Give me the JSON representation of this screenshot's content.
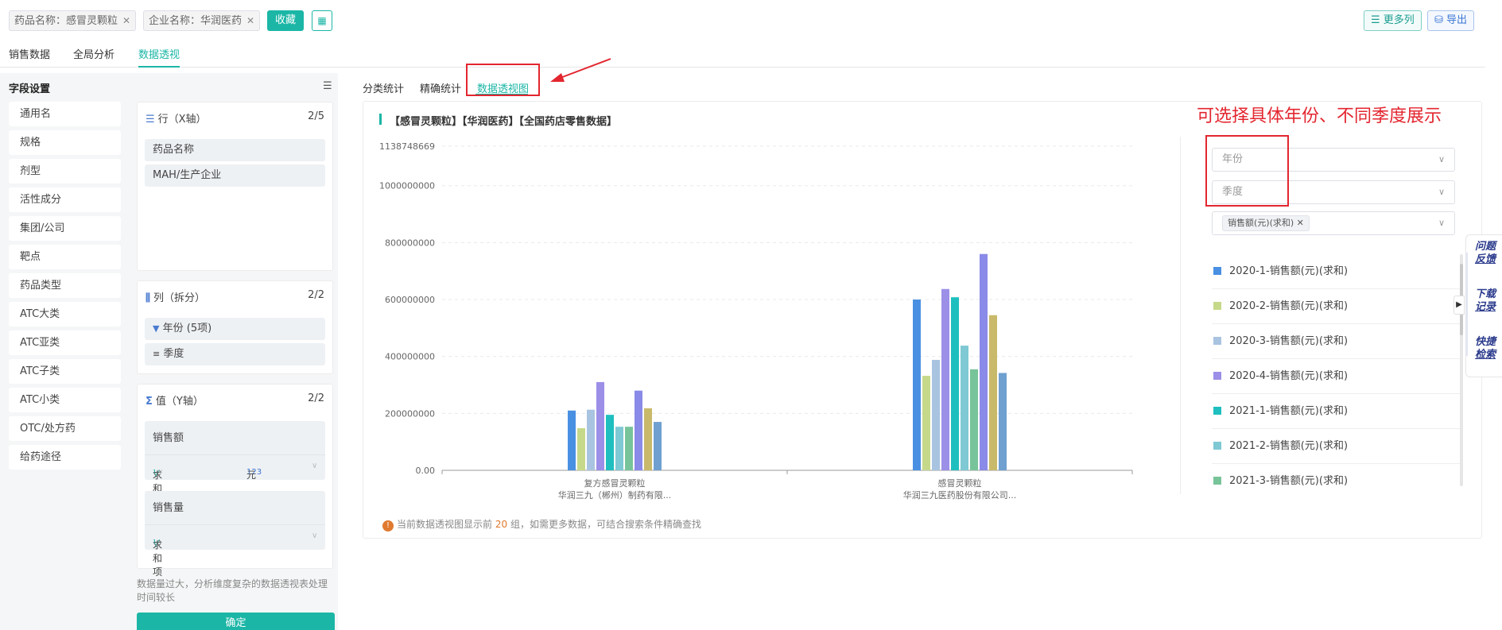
{
  "filters": [
    {
      "label": "药品名称：感冒灵颗粒"
    },
    {
      "label": "企业名称：华润医药"
    }
  ],
  "toolbar": {
    "favorite_label": "收藏",
    "more_columns_label": "更多列",
    "export_label": "导出"
  },
  "main_tabs": [
    "销售数据",
    "全局分析",
    "数据透视"
  ],
  "active_main_tab": "数据透视",
  "field_settings": {
    "title": "字段设置",
    "fields": [
      "通用名",
      "规格",
      "剂型",
      "活性成分",
      "集团/公司",
      "靶点",
      "药品类型",
      "ATC大类",
      "ATC亚类",
      "ATC子类",
      "ATC小类",
      "OTC/处方药",
      "给药途径"
    ]
  },
  "rows_panel": {
    "title": "行（X轴）",
    "count": "2/5",
    "items": [
      "药品名称",
      "MAH/生产企业"
    ]
  },
  "columns_panel": {
    "title": "列（拆分）",
    "count": "2/2",
    "items": [
      "年份 (5项)",
      "季度"
    ]
  },
  "values_panel": {
    "title": "值（Y轴）",
    "count": "2/2",
    "cards": [
      {
        "title": "销售额",
        "agg": "求和项",
        "unit": "元"
      },
      {
        "title": "销售量",
        "agg": "求和项"
      }
    ]
  },
  "note": "数据量过大，分析维度复杂的数据透视表处理时间较长",
  "confirm_label": "确定",
  "sub_tabs": [
    "分类统计",
    "精确统计",
    "数据透视图"
  ],
  "active_sub_tab": "数据透视图",
  "annotation_text": "可选择具体年份、不同季度展示",
  "chart_title": "【感冒灵颗粒】【华润医药】【全国药店零售数据】",
  "footnote": {
    "prefix": "当前数据透视图显示前",
    "count": "20",
    "suffix": "组，如需更多数据，可结合搜索条件精确查找"
  },
  "selectors": {
    "year_placeholder": "年份",
    "quarter_placeholder": "季度",
    "metric_tag": "销售额(元)(求和)"
  },
  "legend": [
    {
      "name": "2020-1-销售额(元)(求和)",
      "color": "#4a90e2"
    },
    {
      "name": "2020-2-销售额(元)(求和)",
      "color": "#c6d98a"
    },
    {
      "name": "2020-3-销售额(元)(求和)",
      "color": "#a9c4e0"
    },
    {
      "name": "2020-4-销售额(元)(求和)",
      "color": "#9b8fe8"
    },
    {
      "name": "2021-1-销售额(元)(求和)",
      "color": "#1fbfbf"
    },
    {
      "name": "2021-2-销售额(元)(求和)",
      "color": "#7ec9d4"
    },
    {
      "name": "2021-3-销售额(元)(求和)",
      "color": "#78c49a"
    }
  ],
  "side_buttons": [
    {
      "line1": "问题",
      "line2": "反馈"
    },
    {
      "line1": "下载",
      "line2": "记录"
    },
    {
      "line1": "快捷",
      "line2": "检索"
    }
  ],
  "chart_data": {
    "type": "bar",
    "y_max_label": "1138748669",
    "y_ticks": [
      "0.00",
      "200000000",
      "400000000",
      "600000000",
      "800000000",
      "1000000000"
    ],
    "ylim": [
      0,
      1138748669
    ],
    "categories": [
      {
        "line1": "复方感冒灵颗粒",
        "line2": "华润三九（郴州）制药有限..."
      },
      {
        "line1": "感冒灵颗粒",
        "line2": "华润三九医药股份有限公司..."
      }
    ],
    "series_colors": [
      "#4a90e2",
      "#c6d98a",
      "#a9c4e0",
      "#9b8fe8",
      "#1fbfbf",
      "#7ec9d4",
      "#78c49a",
      "#8a8ae8",
      "#c9b96a",
      "#6fa0d0"
    ],
    "values": [
      [
        210000000,
        148000000,
        213000000,
        310000000,
        195000000,
        153000000,
        153000000,
        280000000,
        218000000,
        170000000
      ],
      [
        600000000,
        332000000,
        388000000,
        637000000,
        608000000,
        438000000,
        355000000,
        760000000,
        545000000,
        342000000
      ]
    ]
  }
}
